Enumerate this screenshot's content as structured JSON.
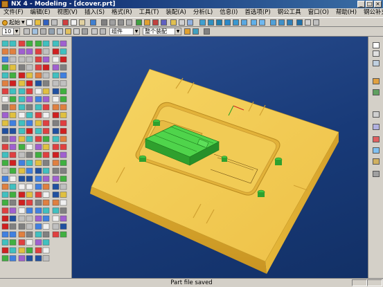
{
  "window": {
    "title": "NX 4 - Modeling - [dcover.prt]"
  },
  "menubar": {
    "items": [
      "文件(F)",
      "编辑(E)",
      "视图(V)",
      "插入(S)",
      "格式(R)",
      "工具(T)",
      "装配(A)",
      "分析(L)",
      "信息(I)",
      "首选项(P)",
      "钢公工具",
      "窗口(O)",
      "帮助(H)",
      "钢公补充"
    ]
  },
  "toolbar": {
    "start_label": "起始",
    "layer_value": "10",
    "filter_value": "组件",
    "scope_value": "整个装配"
  },
  "status": {
    "message": "Part file saved"
  },
  "colors": {
    "background": "#1e407e",
    "mold_base": "#f2c94c",
    "part": "#39c03a",
    "titlebar": "#0a246a"
  },
  "icons": {
    "window": "nx-logo-icon",
    "minimize": "minimize-icon",
    "maximize": "maximize-icon",
    "close": "close-icon"
  }
}
